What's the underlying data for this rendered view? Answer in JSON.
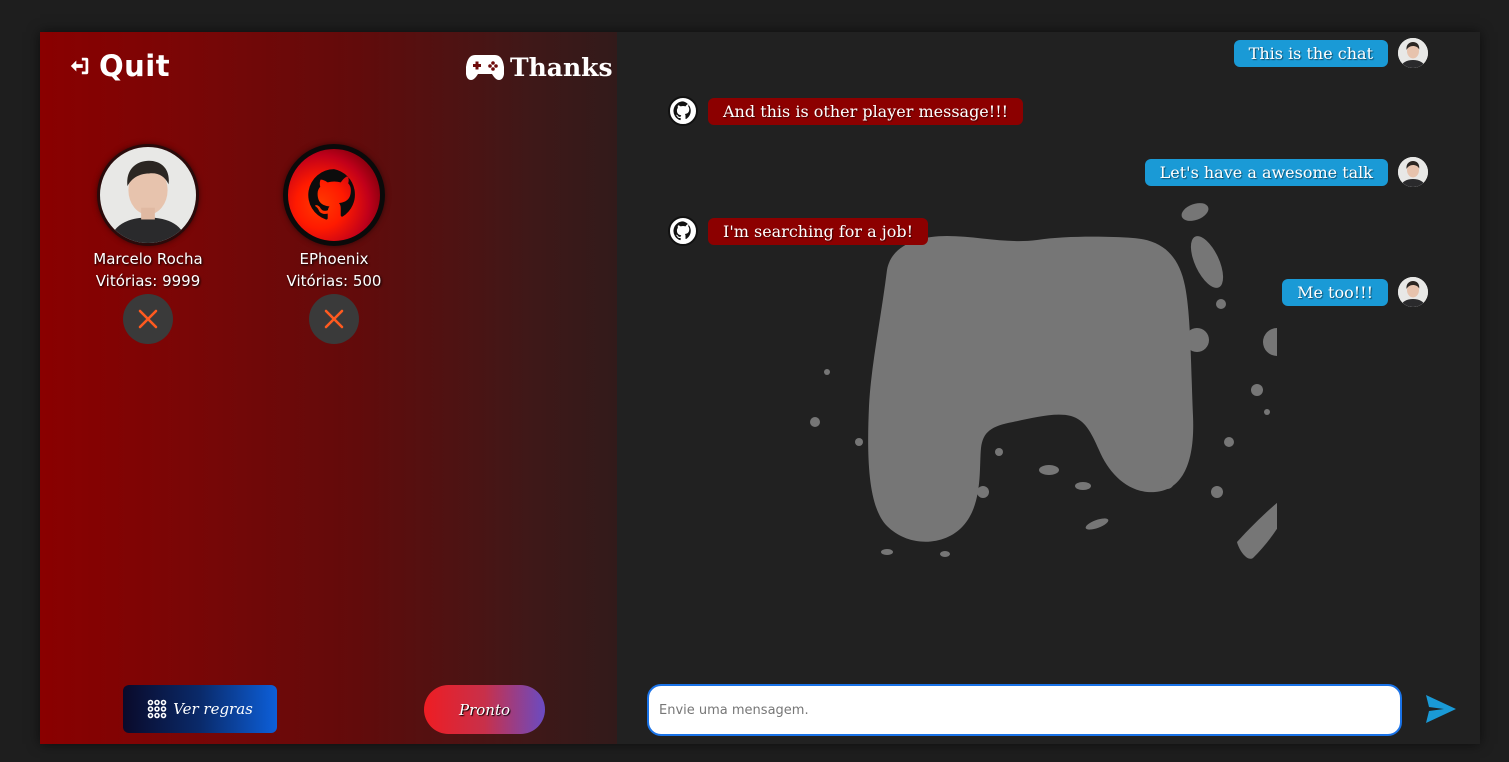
{
  "header": {
    "quit_label": "Quit",
    "title": "Thanks"
  },
  "players": [
    {
      "name": "Marcelo Rocha",
      "wins": "Vitórias: 9999",
      "avatar": "photo",
      "ready": false
    },
    {
      "name": "EPhoenix",
      "wins": "Vitórias: 500",
      "avatar": "github-icon",
      "ready": false
    }
  ],
  "actions": {
    "rules_label": "Ver regras",
    "ready_label": "Pronto"
  },
  "chat": {
    "messages": [
      {
        "text": "This is the chat",
        "from": "me"
      },
      {
        "text": "And this is other player message!!!",
        "from": "other"
      },
      {
        "text": "Let's have a awesome talk",
        "from": "me"
      },
      {
        "text": "I'm searching for a job!",
        "from": "other"
      },
      {
        "text": "Me too!!!",
        "from": "me"
      }
    ],
    "input_placeholder": "Envie uma mensagem."
  },
  "colors": {
    "accent": "#1a9ad6",
    "other_bubble": "#8c0000",
    "status_x": "#ff5a1f",
    "input_border": "#1a73e8"
  }
}
